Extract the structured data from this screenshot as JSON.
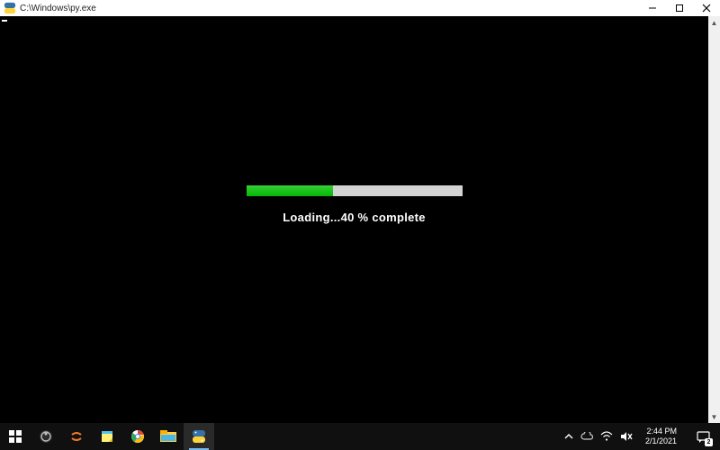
{
  "window": {
    "title": "C:\\Windows\\py.exe",
    "icon": "python-launcher-icon"
  },
  "console": {
    "loading_prefix": "Loading...",
    "progress_percent": 40,
    "loading_suffix": " % complete"
  },
  "taskbar": {
    "items": [
      {
        "name": "start",
        "icon": "windows-logo-icon"
      },
      {
        "name": "obs",
        "icon": "obs-icon"
      },
      {
        "name": "jupyter",
        "icon": "jupyter-icon"
      },
      {
        "name": "sticky-notes",
        "icon": "sticky-notes-icon"
      },
      {
        "name": "chrome",
        "icon": "chrome-icon"
      },
      {
        "name": "file-explorer",
        "icon": "file-explorer-icon"
      },
      {
        "name": "python",
        "icon": "python-icon",
        "active": true
      }
    ]
  },
  "tray": {
    "time": "2:44 PM",
    "date": "2/1/2021",
    "notification_count": "2"
  }
}
